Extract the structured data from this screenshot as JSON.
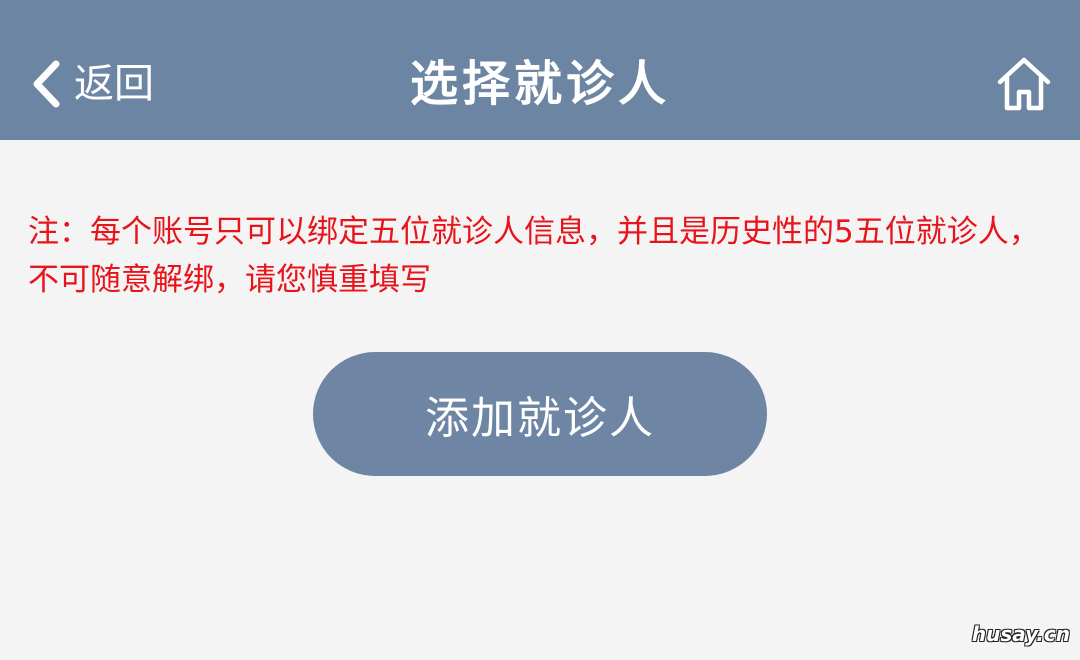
{
  "header": {
    "back_label": "返回",
    "title": "选择就诊人",
    "background_color": "#6c85a3"
  },
  "notice": {
    "text": "注：每个账号只可以绑定五位就诊人信息，并且是历史性的5五位就诊人，不可随意解绑，请您慎重填写",
    "color": "#e8141b"
  },
  "main": {
    "add_button_label": "添加就诊人",
    "add_button_color": "#6e86a4"
  },
  "watermark": "husay.cn",
  "icons": {
    "back": "chevron-left-icon",
    "home": "home-icon"
  }
}
